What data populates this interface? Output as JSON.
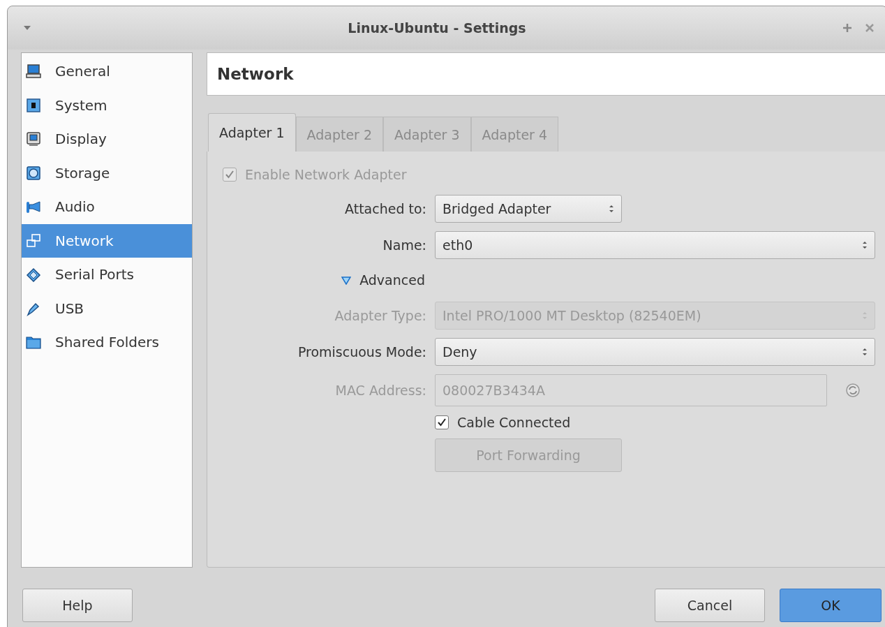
{
  "window": {
    "title": "Linux-Ubuntu - Settings"
  },
  "sidebar": {
    "items": [
      {
        "label": "General",
        "selected": false
      },
      {
        "label": "System",
        "selected": false
      },
      {
        "label": "Display",
        "selected": false
      },
      {
        "label": "Storage",
        "selected": false
      },
      {
        "label": "Audio",
        "selected": false
      },
      {
        "label": "Network",
        "selected": true
      },
      {
        "label": "Serial Ports",
        "selected": false
      },
      {
        "label": "USB",
        "selected": false
      },
      {
        "label": "Shared Folders",
        "selected": false
      }
    ]
  },
  "page_title": "Network",
  "tabs": [
    {
      "label": "Adapter 1",
      "selected": true
    },
    {
      "label": "Adapter 2",
      "selected": false
    },
    {
      "label": "Adapter 3",
      "selected": false
    },
    {
      "label": "Adapter 4",
      "selected": false
    }
  ],
  "enable_adapter": {
    "label": "Enable Network Adapter",
    "checked": true,
    "disabled": true
  },
  "fields": [
    {
      "kind": "combo",
      "label": "Attached to:",
      "value": "Bridged Adapter",
      "disabled": false
    },
    {
      "kind": "combo",
      "label": "Name:",
      "value": "eth0",
      "disabled": false
    },
    {
      "kind": "expander",
      "label": "Advanced",
      "expanded": true
    },
    {
      "kind": "combo",
      "label": "Adapter Type:",
      "value": "Intel PRO/1000 MT Desktop (82540EM)",
      "disabled": true
    },
    {
      "kind": "combo",
      "label": "Promiscuous Mode:",
      "value": "Deny",
      "disabled": false
    },
    {
      "kind": "text",
      "label": "MAC Address:",
      "value": "080027B3434A",
      "disabled": true
    },
    {
      "kind": "check",
      "label": "Cable Connected",
      "checked": true,
      "disabled": false
    },
    {
      "kind": "button",
      "label": "Port Forwarding",
      "disabled": true
    }
  ],
  "buttons": [
    {
      "label": "Help",
      "kind": "normal"
    },
    {
      "label": "Cancel",
      "kind": "normal"
    },
    {
      "label": "OK",
      "kind": "default"
    }
  ]
}
